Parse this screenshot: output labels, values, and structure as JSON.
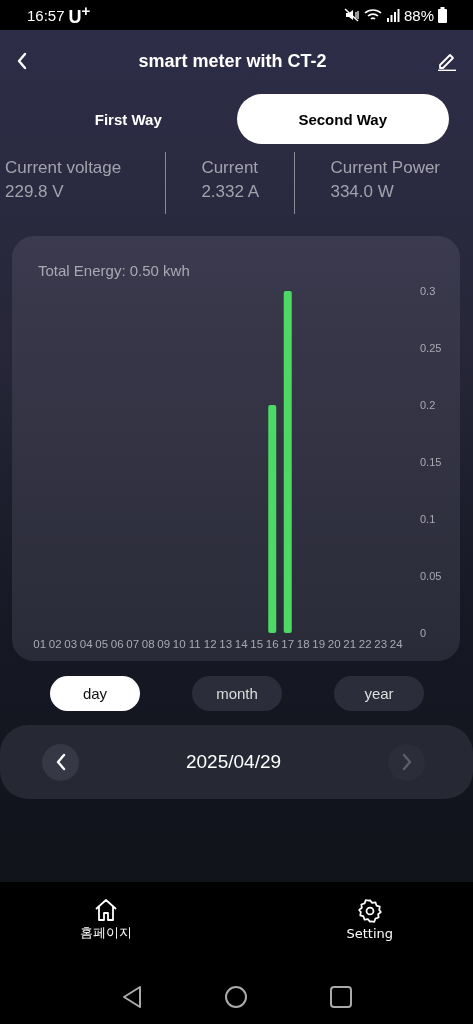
{
  "status_bar": {
    "time": "16:57",
    "carrier": "U$^{+}$",
    "battery": "88%"
  },
  "header": {
    "title": "smart meter with CT-2"
  },
  "tabs": [
    {
      "label": "First Way",
      "selected": false
    },
    {
      "label": "Second Way",
      "selected": true
    }
  ],
  "readings": [
    {
      "label": "Current voltage",
      "value": "229.8 V"
    },
    {
      "label": "Current",
      "value": "2.332 A"
    },
    {
      "label": "Current Power",
      "value": "334.0 W"
    }
  ],
  "energy_card": {
    "title": "Total Energy: 0.50 kwh",
    "chart_data": {
      "type": "bar",
      "categories": [
        "01",
        "02",
        "03",
        "04",
        "05",
        "06",
        "07",
        "08",
        "09",
        "10",
        "11",
        "12",
        "13",
        "14",
        "15",
        "16",
        "17",
        "18",
        "19",
        "20",
        "21",
        "22",
        "23",
        "24"
      ],
      "series": [
        {
          "color": "#4cd964",
          "values": [
            0,
            0,
            0,
            0,
            0,
            0,
            0,
            0,
            0,
            0,
            0,
            0,
            0,
            0,
            0,
            0.2,
            0.3,
            0,
            0,
            0,
            0,
            0,
            0,
            0
          ]
        }
      ],
      "ylim": [
        0,
        0.3
      ],
      "yticks": [
        0,
        0.05,
        0.1,
        0.15,
        0.2,
        0.25,
        0.3
      ]
    }
  },
  "periods": [
    {
      "label": "day",
      "selected": true
    },
    {
      "label": "month",
      "selected": false
    },
    {
      "label": "year",
      "selected": false
    }
  ],
  "date_bar": {
    "date": "2025/04/29",
    "prev_disabled": false,
    "next_disabled": true
  },
  "bottom_nav": [
    {
      "label": "홈페이지",
      "kind": "home"
    },
    {
      "label": "Setting",
      "kind": "settings"
    }
  ]
}
